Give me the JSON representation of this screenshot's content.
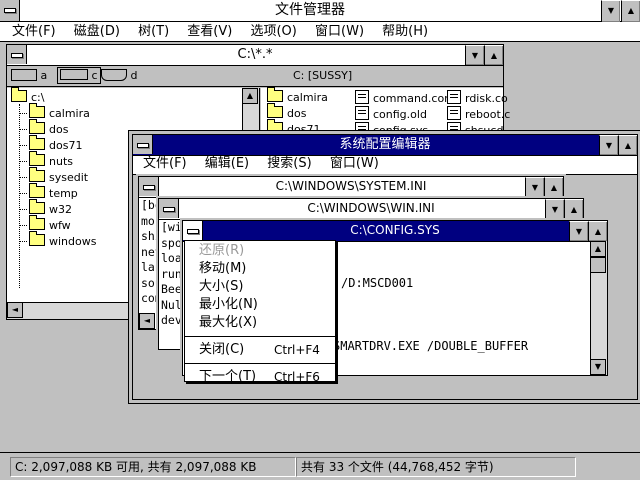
{
  "app": {
    "title": "文件管理器",
    "menu": [
      "文件(F)",
      "磁盘(D)",
      "树(T)",
      "查看(V)",
      "选项(O)",
      "窗口(W)",
      "帮助(H)"
    ]
  },
  "dir_window": {
    "title": "C:\\*.*",
    "drives": [
      "a",
      "c",
      "d"
    ],
    "volume": "C: [SUSSY]",
    "tree_root": "c:\\",
    "tree": [
      "calmira",
      "dos",
      "dos71",
      "nuts",
      "sysedit",
      "temp",
      "w32",
      "wfw",
      "windows"
    ],
    "files_col1": [
      "calmira",
      "dos",
      "dos71"
    ],
    "files_col2": [
      "command.com",
      "config.old",
      "config.sys"
    ],
    "files_col3": [
      "rdisk.co",
      "reboot.c",
      "shsucd"
    ]
  },
  "sysedit": {
    "title": "系统配置编辑器",
    "menu": [
      "文件(F)",
      "编辑(E)",
      "搜索(S)",
      "窗口(W)"
    ],
    "win_system": {
      "title": "C:\\WINDOWS\\SYSTEM.INI",
      "lines": [
        "[bo",
        "mo",
        "shi",
        "net",
        "lan",
        "sou",
        "com"
      ]
    },
    "win_win": {
      "title": "C:\\WINDOWS\\WIN.INI",
      "lines": [
        "[wi",
        "spo",
        "loa",
        "run",
        "Bee",
        "Nul",
        "dev"
      ]
    },
    "win_config": {
      "title": "C:\\CONFIG.SYS",
      "line1": "/D:MSCD001",
      "line2": "SMARTDRV.EXE /DOUBLE_BUFFER"
    }
  },
  "sysmenu": {
    "restore": "还原(R)",
    "move": "移动(M)",
    "size": "大小(S)",
    "minimize": "最小化(N)",
    "maximize": "最大化(X)",
    "close": "关闭(C)",
    "close_acc": "Ctrl+F4",
    "next": "下一个(T)",
    "next_acc": "Ctrl+F6"
  },
  "status": {
    "left": "C: 2,097,088 KB 可用, 共有 2,097,088 KB",
    "right": "共有 33 个文件 (44,768,452 字节)"
  }
}
